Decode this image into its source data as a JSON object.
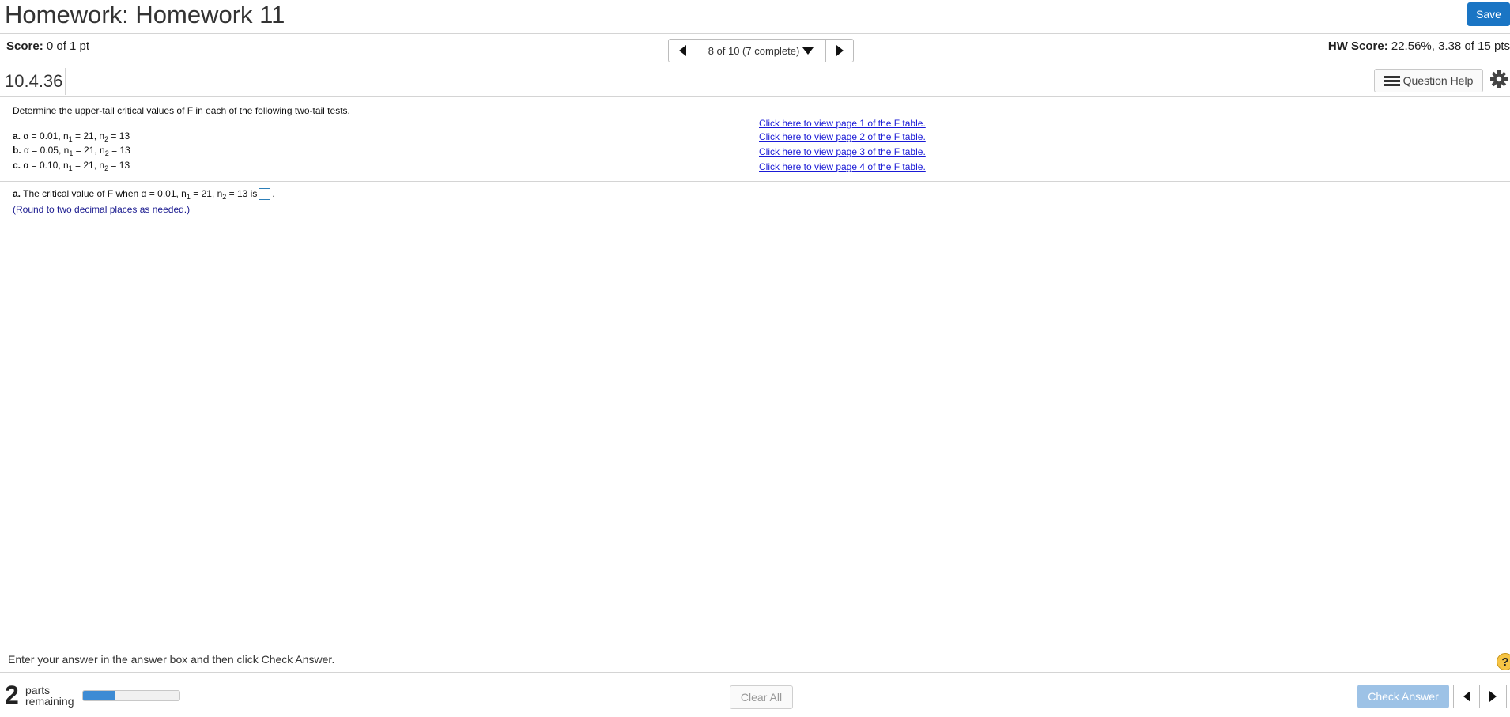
{
  "header": {
    "title": "Homework: Homework 11",
    "save_label": "Save"
  },
  "score": {
    "label": "Score:",
    "value": "0 of 1 pt"
  },
  "nav": {
    "position_text": "8 of 10 (7 complete)"
  },
  "hw_score": {
    "label": "HW Score:",
    "value": "22.56%, 3.38 of 15 pts"
  },
  "question": {
    "id": "10.4.36",
    "help_label": "Question Help",
    "prompt": "Determine the upper-tail critical values of F in each of the following two-tail tests.",
    "items": [
      {
        "letter": "a.",
        "alpha": "0.01",
        "n1": "21",
        "n2": "13"
      },
      {
        "letter": "b.",
        "alpha": "0.05",
        "n1": "21",
        "n2": "13"
      },
      {
        "letter": "c.",
        "alpha": "0.10",
        "n1": "21",
        "n2": "13"
      }
    ],
    "table_links": [
      "Click here to view page 1 of the F table.",
      "Click here to view page 2 of the F table.",
      "Click here to view page 3 of the F table.",
      "Click here to view page 4 of the F table."
    ],
    "answer_part": {
      "letter": "a.",
      "text_before": "The critical value of F when",
      "alpha": "0.01",
      "n1": "21",
      "n2": "13",
      "text_after": "is",
      "answer_value": "",
      "note": "(Round to two decimal places as needed.)"
    }
  },
  "footer": {
    "instruction": "Enter your answer in the answer box and then click Check Answer.",
    "parts_count": "2",
    "parts_label_1": "parts",
    "parts_label_2": "remaining",
    "progress_fraction": 0.33,
    "clear_label": "Clear All",
    "check_label": "Check Answer",
    "help_symbol": "?"
  },
  "colors": {
    "primary": "#1a75c4",
    "link": "#1a1ad6",
    "check_disabled": "#9dc2e6",
    "progress": "#3d8bd4",
    "help_yellow": "#f6c445"
  },
  "icons": [
    "chevron-left-icon",
    "chevron-right-icon",
    "caret-down-icon",
    "list-icon",
    "gear-icon",
    "help-icon"
  ]
}
